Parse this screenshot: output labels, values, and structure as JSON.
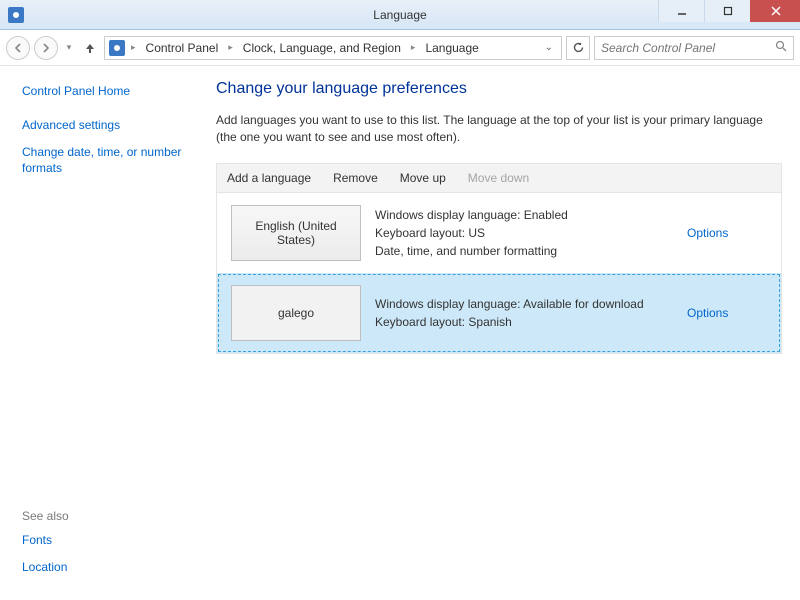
{
  "window": {
    "title": "Language"
  },
  "nav": {
    "crumbs": [
      "Control Panel",
      "Clock, Language, and Region",
      "Language"
    ],
    "search_placeholder": "Search Control Panel"
  },
  "sidebar": {
    "home": "Control Panel Home",
    "links": [
      "Advanced settings",
      "Change date, time, or number formats"
    ],
    "seealso_header": "See also",
    "seealso": [
      "Fonts",
      "Location"
    ]
  },
  "main": {
    "heading": "Change your language preferences",
    "description": "Add languages you want to use to this list. The language at the top of your list is your primary language (the one you want to see and use most often).",
    "toolbar": {
      "add": "Add a language",
      "remove": "Remove",
      "moveup": "Move up",
      "movedown": "Move down"
    },
    "options_label": "Options",
    "languages": [
      {
        "name": "English (United States)",
        "line1": "Windows display language: Enabled",
        "line2": "Keyboard layout: US",
        "line3": "Date, time, and number formatting",
        "selected": false
      },
      {
        "name": "galego",
        "line1": "Windows display language: Available for download",
        "line2": "Keyboard layout: Spanish",
        "line3": "",
        "selected": true
      }
    ]
  }
}
